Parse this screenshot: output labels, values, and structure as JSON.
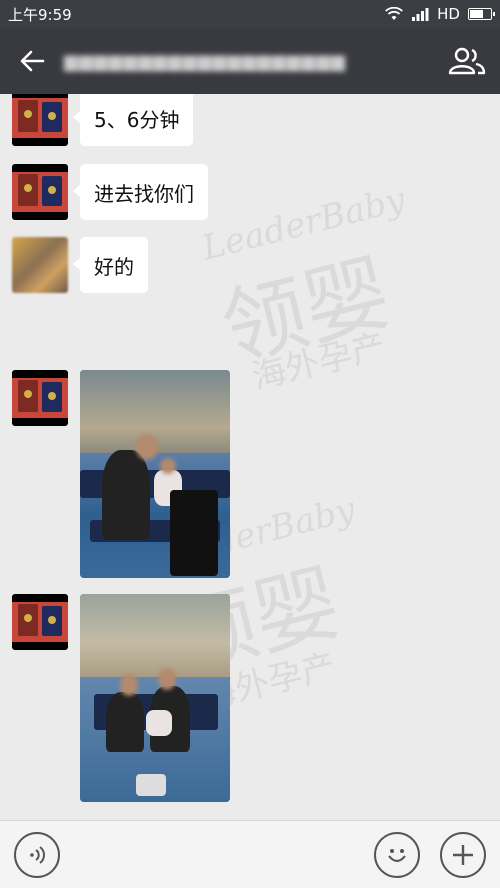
{
  "status_bar": {
    "time": "上午9:59",
    "network_label": "HD",
    "battery_level": 0.7
  },
  "title_bar": {
    "back_icon": "back-arrow-icon",
    "members_icon": "group-members-icon"
  },
  "watermark": {
    "brand_en": "LeaderBaby",
    "brand_cn": "领婴",
    "tagline_cn": "海外孕产"
  },
  "messages": [
    {
      "type": "text",
      "text": "5、6分钟",
      "avatar": "passport-avatar"
    },
    {
      "type": "text",
      "text": "进去找你们",
      "avatar": "passport-avatar"
    },
    {
      "type": "text",
      "text": "好的",
      "avatar": "blurred-avatar"
    },
    {
      "type": "image",
      "avatar": "passport-avatar",
      "content": "airport-waiting-area-photo"
    },
    {
      "type": "image",
      "avatar": "passport-avatar",
      "content": "airport-family-photo"
    }
  ],
  "bottom_bar": {
    "voice_icon": "voice-input-icon",
    "emoji_icon": "emoji-icon",
    "more_icon": "plus-icon"
  },
  "colors": {
    "header_bg": "#393a3f",
    "status_bg": "#3b3e43",
    "chat_bg": "#ebebeb",
    "bubble_bg": "#ffffff",
    "bottom_bg": "#f4f4f4"
  }
}
